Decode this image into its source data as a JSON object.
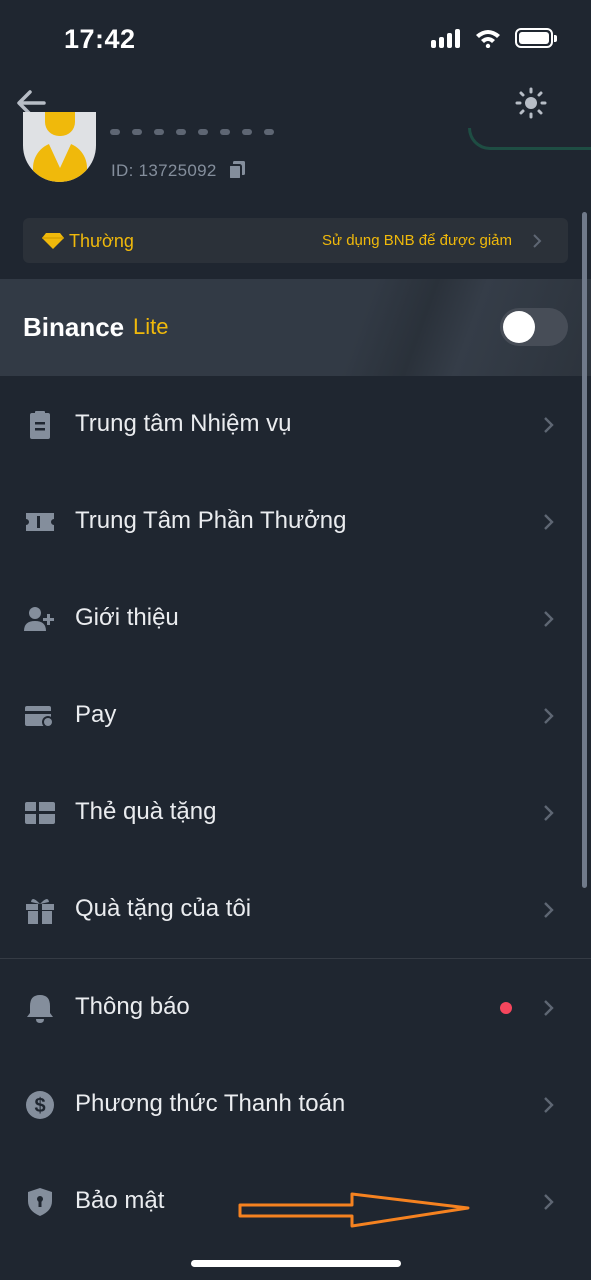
{
  "status_bar": {
    "time": "17:42",
    "icons": [
      "signal-icon",
      "wifi-icon",
      "battery-icon"
    ]
  },
  "nav": {
    "back_icon": "arrow-left-icon",
    "settings_icon": "gear-icon"
  },
  "profile": {
    "user_id": "ID: 13725092",
    "copy_icon": "copy-icon"
  },
  "tier": {
    "label": "Thường",
    "promo": "Sử dụng BNB để được giảm",
    "icon": "diamond-icon"
  },
  "lite": {
    "title": "Binance",
    "suffix": "Lite",
    "toggle_on": false
  },
  "menu": {
    "items": [
      {
        "label": "Trung tâm Nhiệm vụ",
        "icon": "clipboard-icon"
      },
      {
        "label": "Trung Tâm Phần Thưởng",
        "icon": "ticket-icon"
      },
      {
        "label": "Giới thiệu",
        "icon": "add-user-icon"
      },
      {
        "label": "Pay",
        "icon": "pay-card-icon"
      },
      {
        "label": "Thẻ quà tặng",
        "icon": "gift-card-icon"
      },
      {
        "label": "Quà tặng của tôi",
        "icon": "gift-icon"
      },
      {
        "label": "Thông báo",
        "icon": "bell-icon",
        "has_dot": true
      },
      {
        "label": "Phương thức Thanh toán",
        "icon": "dollar-circle-icon"
      },
      {
        "label": "Bảo mật",
        "icon": "shield-icon"
      }
    ]
  },
  "colors": {
    "background": "#1f2630",
    "accent": "#f0b90b",
    "text": "#eaecef",
    "muted": "#848e9c",
    "notification": "#f6465d",
    "annotation": "#f58220"
  }
}
